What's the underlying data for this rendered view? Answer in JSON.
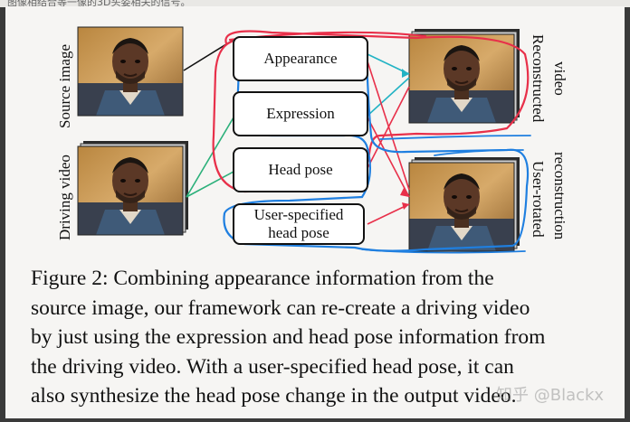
{
  "top_text": "图像相结合等一像的3D头姿相关的信号。",
  "figure": {
    "left_labels": [
      "Source image",
      "Driving video"
    ],
    "right_labels": [
      [
        "Reconstructed",
        "video"
      ],
      [
        "User-rotated",
        "reconstruction"
      ]
    ],
    "boxes": [
      "Appearance",
      "Expression",
      "Head pose",
      "User-specified head pose"
    ],
    "annotation_colors": {
      "red": "#e8304a",
      "blue": "#1f7fe0",
      "green": "#2bb07a",
      "teal": "#22b3c4"
    }
  },
  "caption": {
    "lines": [
      "Figure 2:  Combining appearance information from the",
      "source image, our framework can re-create a driving video",
      "by just using the expression and head pose information from",
      "the driving video. With a user-specified head pose, it can",
      "also synthesize the head pose change in the output video."
    ]
  },
  "watermark": "知乎 @Blackx"
}
